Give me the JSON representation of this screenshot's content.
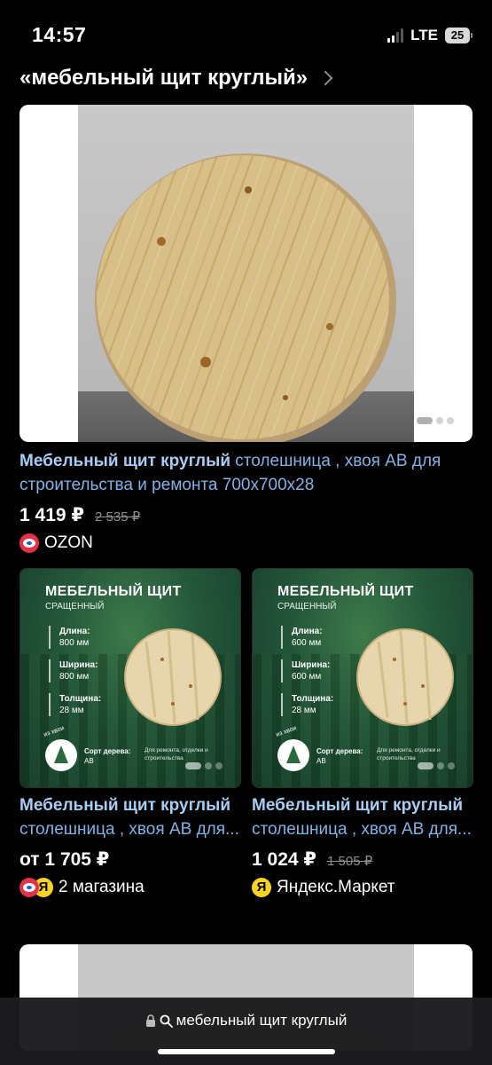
{
  "status_bar": {
    "time": "14:57",
    "network": "LTE",
    "battery": "25"
  },
  "header": {
    "query": "«мебельный щит круглый»"
  },
  "products": [
    {
      "title_bold": "Мебельный щит круглый",
      "title_rest": " столешница , хвоя АВ для строительства и ремонта 700х700х28",
      "price": "1 419 ₽",
      "old_price": "2 535 ₽",
      "shop": "OZON",
      "image_pages": 3
    },
    {
      "title_bold": "Мебельный щит круглый",
      "title_rest": " столешница , хвоя АВ для...",
      "price": "от 1 705 ₽",
      "shop": "2 магазина",
      "image": {
        "heading": "МЕБЕЛЬНЫЙ ЩИТ",
        "subheading": "СРАЩЕННЫЙ",
        "specs": [
          {
            "label": "Длина:",
            "value": "800 мм"
          },
          {
            "label": "Ширина:",
            "value": "800 мм"
          },
          {
            "label": "Толщина:",
            "value": "28 мм"
          }
        ],
        "badge": "из хвои",
        "sort_label": "Сорт дерева:",
        "sort_value": "АВ",
        "note": "Для ремонта, отделки и строительства"
      }
    },
    {
      "title_bold": "Мебельный щит круглый",
      "title_rest": " столешница , хвоя АВ для...",
      "price": "1 024 ₽",
      "old_price": "1 505 ₽",
      "shop": "Яндекс.Маркет",
      "image": {
        "heading": "МЕБЕЛЬНЫЙ ЩИТ",
        "subheading": "СРАЩЕННЫЙ",
        "specs": [
          {
            "label": "Длина:",
            "value": "600 мм"
          },
          {
            "label": "Ширина:",
            "value": "600 мм"
          },
          {
            "label": "Толщина:",
            "value": "28 мм"
          }
        ],
        "badge": "из хвои",
        "sort_label": "Сорт дерева:",
        "sort_value": "АВ",
        "note": "Для ремонта, отделки и строительства"
      }
    }
  ],
  "bottom_bar": {
    "address": "мебельный щит круглый"
  }
}
